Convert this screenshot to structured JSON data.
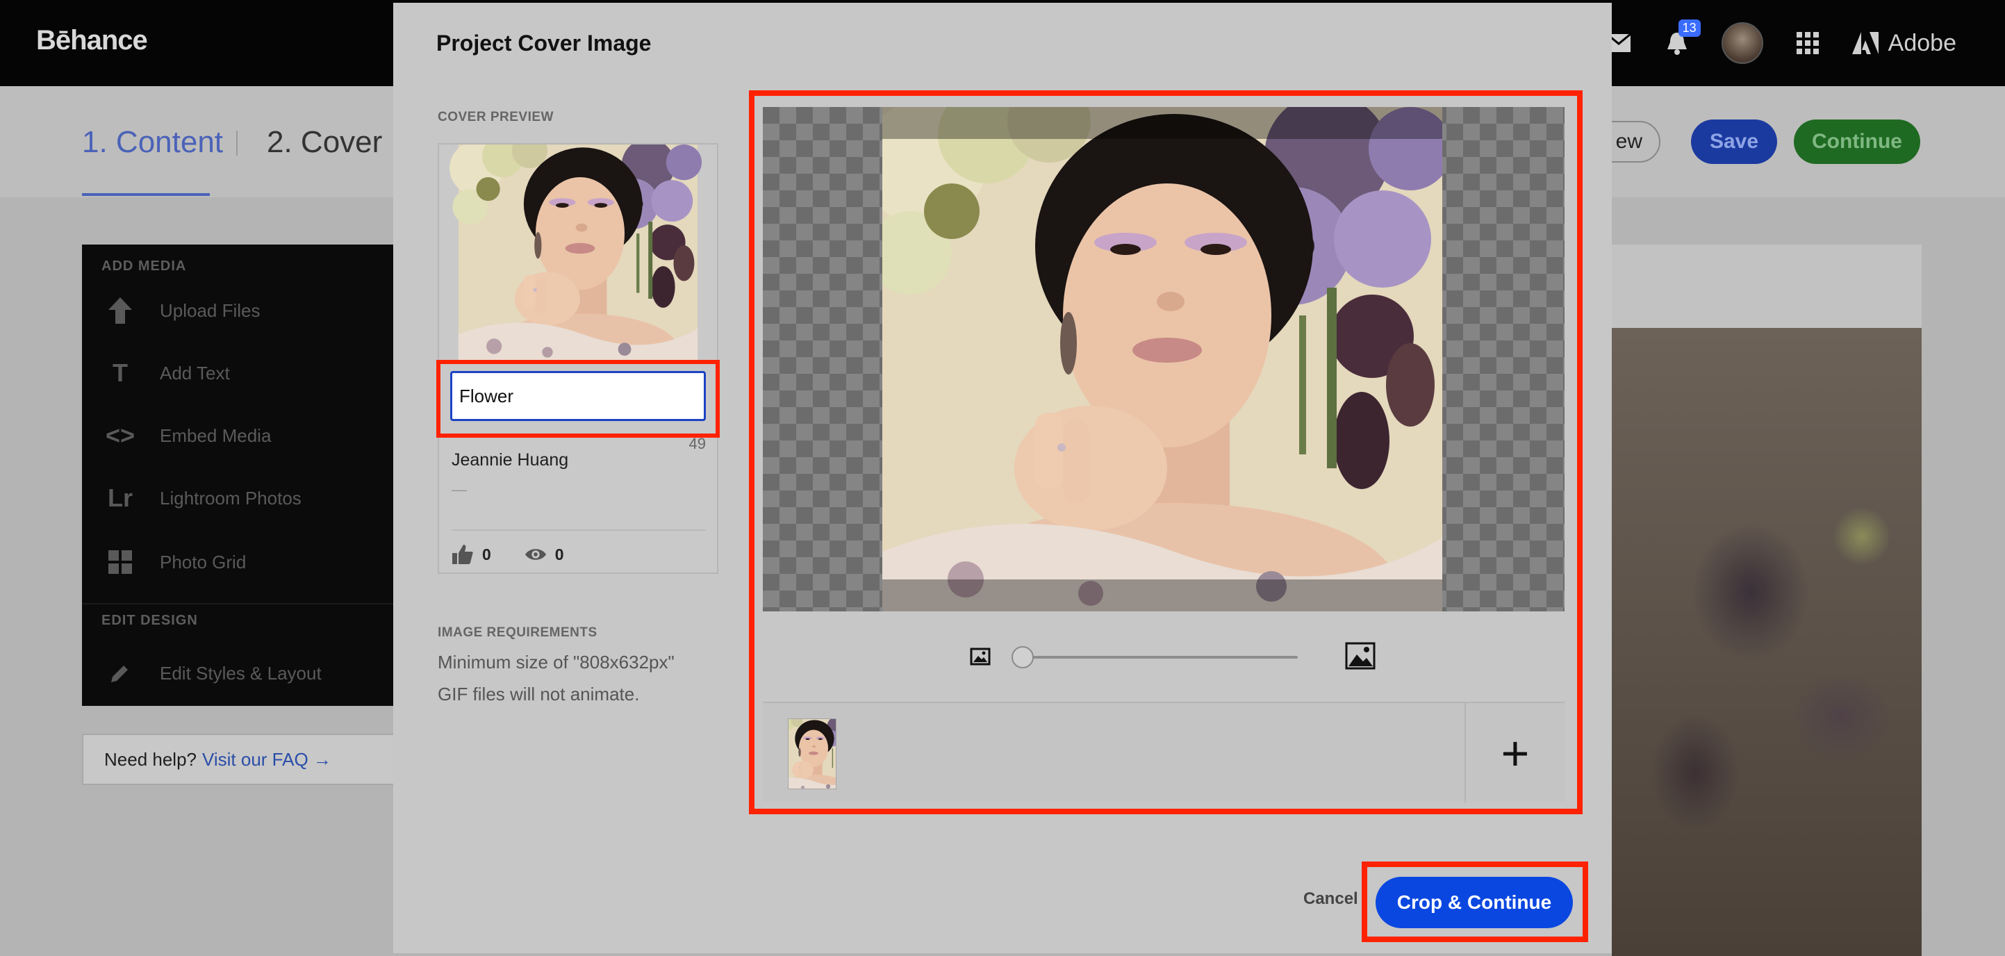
{
  "app": {
    "logo": "Bēhance",
    "notification_count": "13",
    "adobe_label": "Adobe"
  },
  "steps": {
    "step1": "1. Content",
    "step2": "2. Cover",
    "preview_partial": "ew",
    "save": "Save",
    "continue": "Continue"
  },
  "sidebar": {
    "add_media_heading": "ADD MEDIA",
    "items": [
      {
        "label": "Upload Files",
        "icon": "upload-arrow-icon"
      },
      {
        "label": "Add Text",
        "icon": "text-t-icon"
      },
      {
        "label": "Embed Media",
        "icon": "code-brackets-icon"
      },
      {
        "label": "Lightroom Photos",
        "icon": "lightroom-icon"
      },
      {
        "label": "Photo Grid",
        "icon": "grid-icon"
      }
    ],
    "edit_design_heading": "EDIT DESIGN",
    "edit_item": {
      "label": "Edit Styles & Layout",
      "icon": "pencil-icon"
    },
    "icon_glyphs": {
      "text": "T",
      "code": "<>",
      "lightroom": "Lr"
    }
  },
  "help": {
    "text": "Need help?",
    "link": "Visit our FAQ →"
  },
  "modal": {
    "title": "Project Cover Image",
    "cover_preview_label": "COVER PREVIEW",
    "card": {
      "title_value": "Flower",
      "char_count": "49",
      "owner": "Jeannie Huang",
      "dash": "—",
      "likes": "0",
      "views": "0"
    },
    "requirements_label": "IMAGE REQUIREMENTS",
    "requirements": [
      "Minimum size of \"808x632px\"",
      "GIF files will not animate."
    ],
    "zoom_level": 0,
    "add_glyph": "+",
    "cancel": "Cancel",
    "crop_continue": "Crop & Continue"
  },
  "colors": {
    "highlight": "#ff2200",
    "primary": "#0a47e0"
  }
}
